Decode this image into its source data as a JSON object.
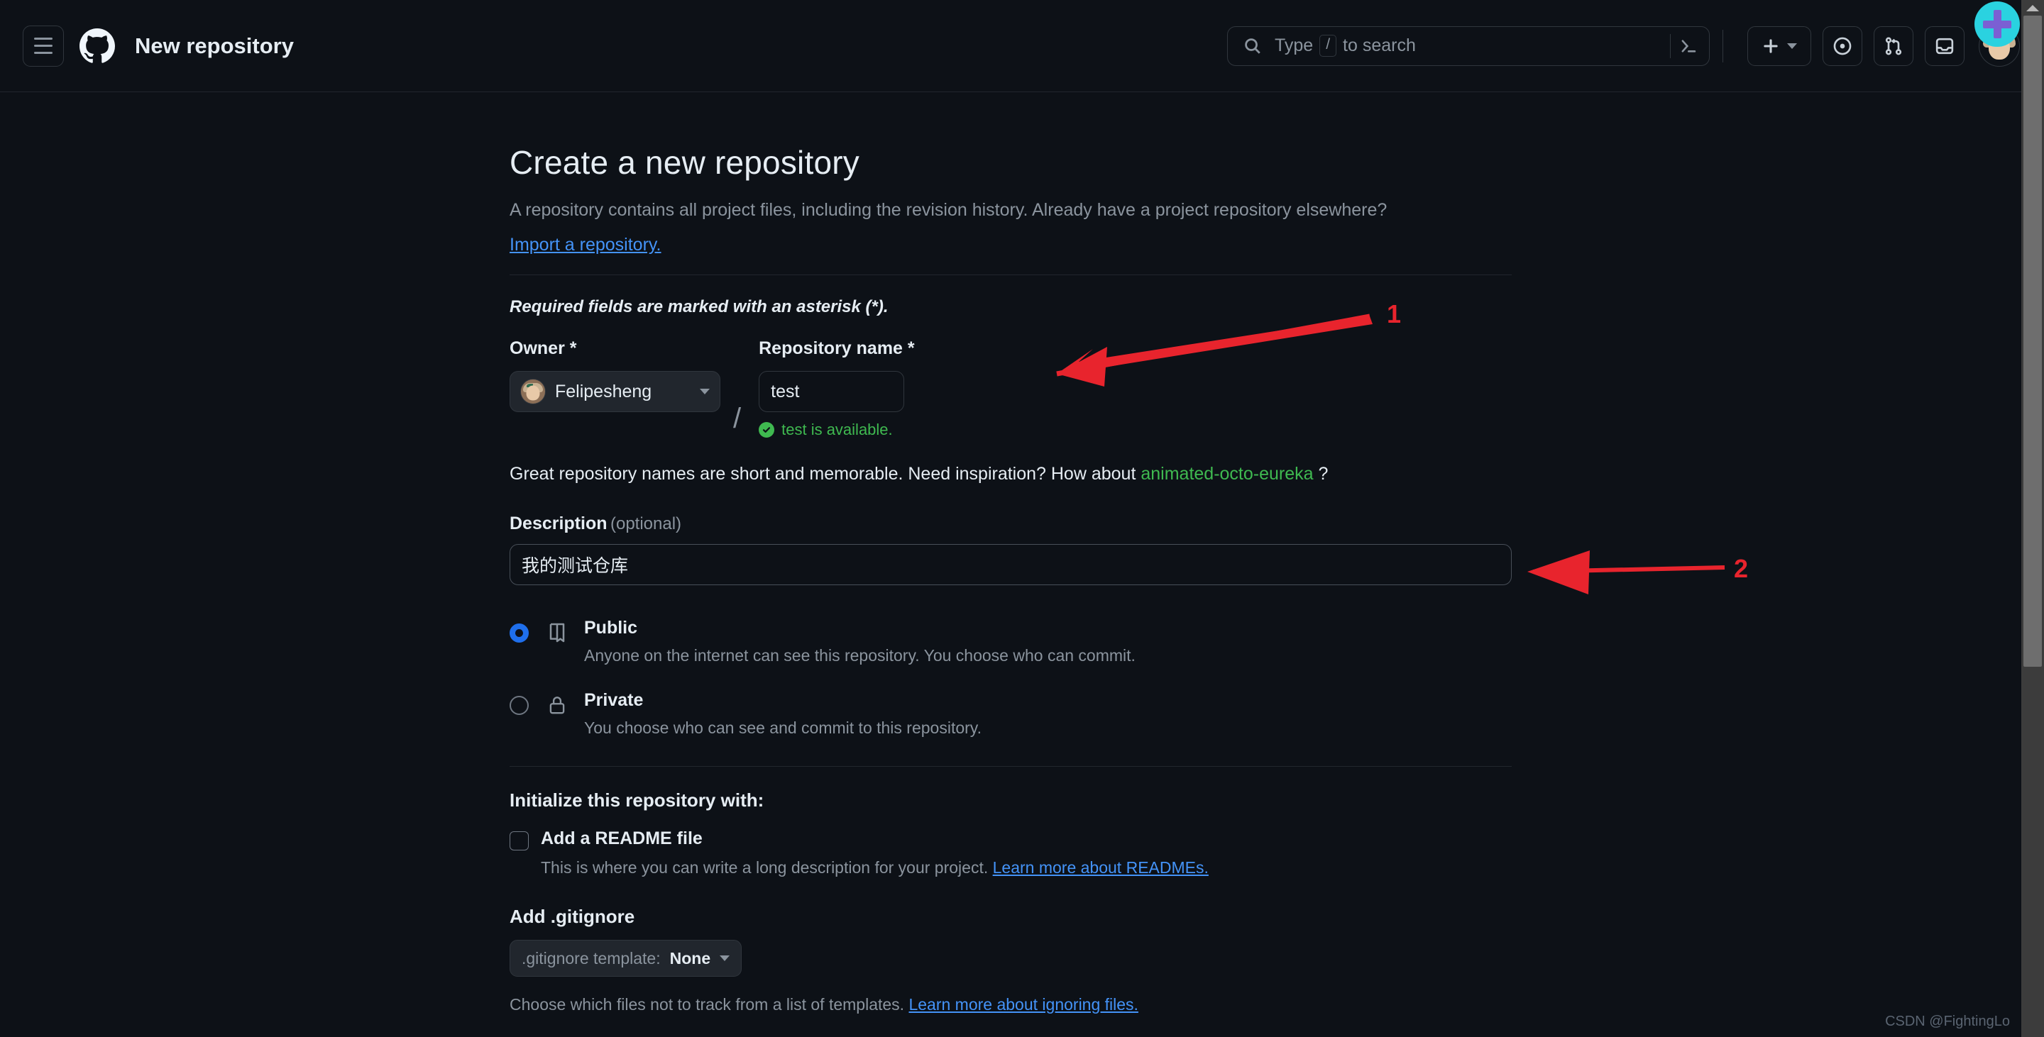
{
  "header": {
    "menu_icon": "hamburger-menu-icon",
    "logo_icon": "github-logo-icon",
    "title": "New repository",
    "search": {
      "placeholder_prefix": "Type",
      "slash_key": "/",
      "placeholder_suffix": "to search",
      "icon": "search-icon",
      "terminal_icon": "terminal-icon"
    },
    "create_new_label": "+",
    "icons": {
      "plus": "plus-icon",
      "caret": "chevron-down-icon",
      "issues": "issues-icon",
      "pull_requests": "pull-requests-icon",
      "inbox": "inbox-icon",
      "avatar": "user-avatar"
    }
  },
  "main": {
    "page_title": "Create a new repository",
    "page_description": "A repository contains all project files, including the revision history. Already have a project repository elsewhere?",
    "import_link": "Import a repository.",
    "required_note": "Required fields are marked with an asterisk (*).",
    "owner": {
      "label": "Owner *",
      "value": "Felipesheng",
      "separator": "/"
    },
    "repository_name": {
      "label": "Repository name *",
      "value": "test",
      "availability_text": "test is available.",
      "availability_color": "#3fb950"
    },
    "inspiration": {
      "prefix": "Great repository names are short and memorable. Need inspiration? How about",
      "suggestion": "animated-octo-eureka",
      "suffix": "?"
    },
    "description": {
      "label": "Description",
      "optional": "(optional)",
      "value": "我的测试仓库"
    },
    "visibility": {
      "options": [
        {
          "id": "public",
          "title": "Public",
          "description": "Anyone on the internet can see this repository. You choose who can commit.",
          "selected": true,
          "icon": "book-icon"
        },
        {
          "id": "private",
          "title": "Private",
          "description": "You choose who can see and commit to this repository.",
          "selected": false,
          "icon": "lock-icon"
        }
      ]
    },
    "initialize": {
      "title": "Initialize this repository with:",
      "readme": {
        "label": "Add a README file",
        "description": "This is where you can write a long description for your project.",
        "link": "Learn more about READMEs.",
        "checked": false
      }
    },
    "gitignore": {
      "title": "Add .gitignore",
      "select_label": ".gitignore template:",
      "select_value": "None",
      "description": "Choose which files not to track from a list of templates.",
      "link": "Learn more about ignoring files."
    }
  },
  "annotations": [
    {
      "number": "1",
      "color": "#e8242d"
    },
    {
      "number": "2",
      "color": "#e8242d"
    }
  ],
  "watermark": "CSDN @FightingLo",
  "colors": {
    "background": "#0d1117",
    "border": "#30363d",
    "accent_blue": "#1f6feb",
    "link_blue": "#4493f8",
    "green": "#3fb950",
    "text": "#e6edf3",
    "muted": "#8b949e",
    "annotation_red": "#e8242d",
    "cursor_cyan": "#2ad2e0",
    "cursor_purple": "#7b5fd3"
  }
}
